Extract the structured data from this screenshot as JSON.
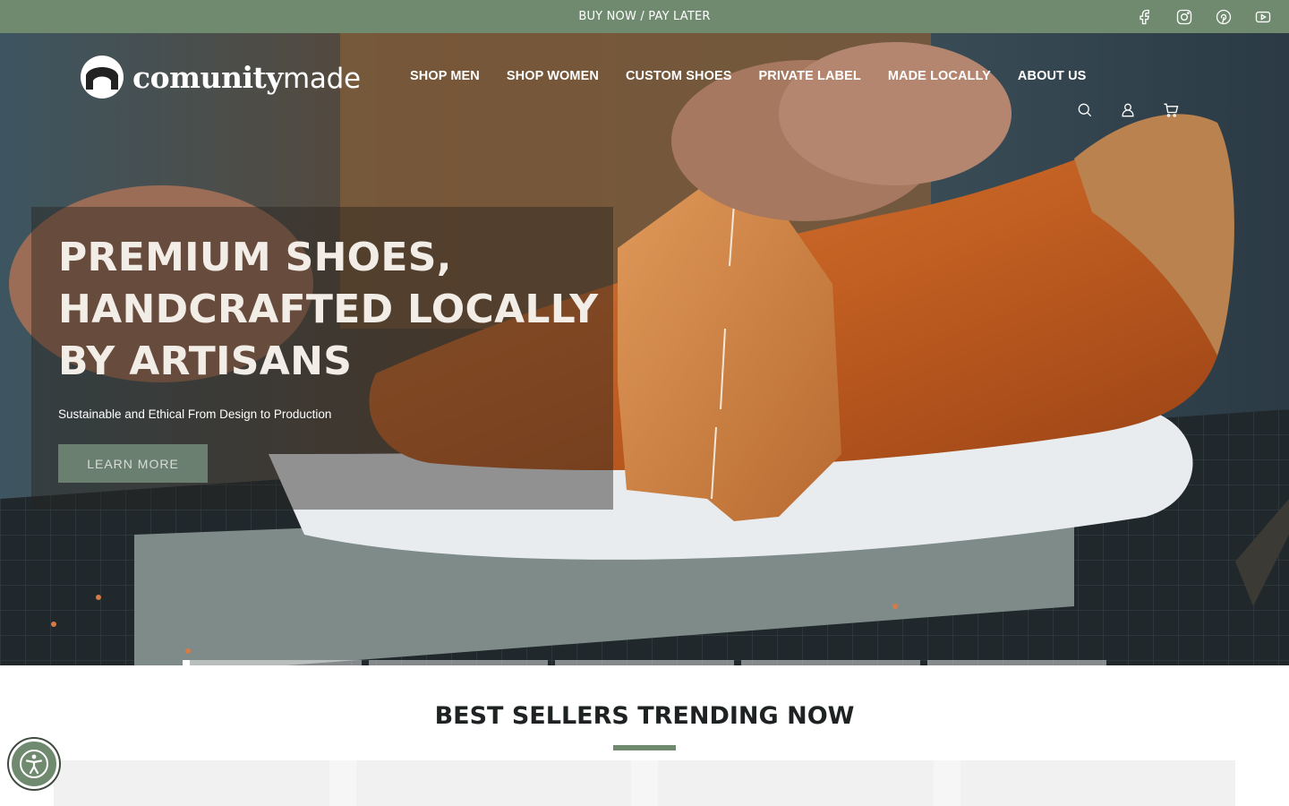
{
  "colors": {
    "accent": "#6f8a6f",
    "hero_leather": "#c8692a",
    "panel_text": "#f2ede6"
  },
  "announcement": {
    "text": "BUY NOW / PAY LATER"
  },
  "social_icons": [
    "facebook-icon",
    "instagram-icon",
    "pinterest-icon",
    "youtube-icon"
  ],
  "brand": {
    "bold": "comunity",
    "light": "made"
  },
  "nav": {
    "items": [
      "SHOP MEN",
      "SHOP WOMEN",
      "CUSTOM SHOES",
      "PRIVATE LABEL",
      "MADE LOCALLY",
      "ABOUT US"
    ]
  },
  "header_icons": [
    "search-icon",
    "account-icon",
    "cart-icon"
  ],
  "hero": {
    "headline": "PREMIUM SHOES, HANDCRAFTED LOCALLY BY ARTISANS",
    "subline": "Sustainable and Ethical From Design to Production",
    "cta": "LEARN MORE",
    "slide_count": 5,
    "active_slide": 1
  },
  "best_sellers": {
    "title": "BEST SELLERS TRENDING NOW"
  }
}
